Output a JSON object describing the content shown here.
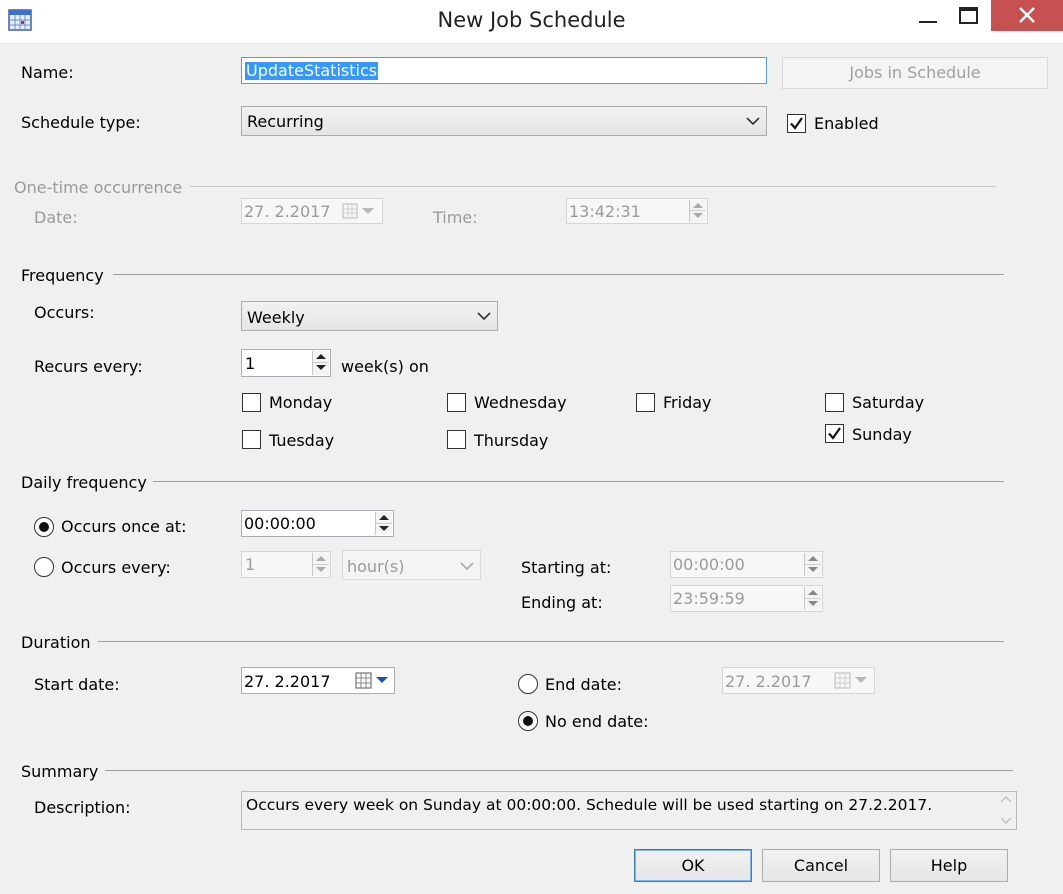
{
  "window": {
    "title": "New Job Schedule",
    "app_icon": "calendar-grid-icon",
    "close_color": "#c75050"
  },
  "general": {
    "name_label": "Name:",
    "name_value": "UpdateStatistics",
    "jobs_button": "Jobs in Schedule",
    "schedule_type_label": "Schedule type:",
    "schedule_type_value": "Recurring",
    "enabled_label": "Enabled",
    "enabled_checked": true
  },
  "one_time": {
    "header": "One-time occurrence",
    "date_label": "Date:",
    "date_value": "27.  2.2017",
    "time_label": "Time:",
    "time_value": "13:42:31"
  },
  "frequency": {
    "header": "Frequency",
    "occurs_label": "Occurs:",
    "occurs_value": "Weekly",
    "recurs_label": "Recurs every:",
    "recurs_value": "1",
    "recurs_suffix": "week(s) on",
    "days": {
      "monday": {
        "label": "Monday",
        "checked": false
      },
      "tuesday": {
        "label": "Tuesday",
        "checked": false
      },
      "wednesday": {
        "label": "Wednesday",
        "checked": false
      },
      "thursday": {
        "label": "Thursday",
        "checked": false
      },
      "friday": {
        "label": "Friday",
        "checked": false
      },
      "saturday": {
        "label": "Saturday",
        "checked": false
      },
      "sunday": {
        "label": "Sunday",
        "checked": true
      }
    }
  },
  "daily": {
    "header": "Daily frequency",
    "once_label": "Occurs once at:",
    "once_selected": true,
    "once_value": "00:00:00",
    "every_label": "Occurs every:",
    "every_selected": false,
    "every_value": "1",
    "every_unit": "hour(s)",
    "starting_label": "Starting at:",
    "starting_value": "00:00:00",
    "ending_label": "Ending at:",
    "ending_value": "23:59:59"
  },
  "duration": {
    "header": "Duration",
    "start_label": "Start date:",
    "start_value": "27.  2.2017",
    "end_date_label": "End date:",
    "end_date_selected": false,
    "end_date_value": "27.  2.2017",
    "no_end_label": "No end date:",
    "no_end_selected": true
  },
  "summary": {
    "header": "Summary",
    "description_label": "Description:",
    "description_value": "Occurs every week on Sunday at 00:00:00. Schedule will be used starting on 27.2.2017."
  },
  "buttons": {
    "ok": "OK",
    "cancel": "Cancel",
    "help": "Help"
  }
}
